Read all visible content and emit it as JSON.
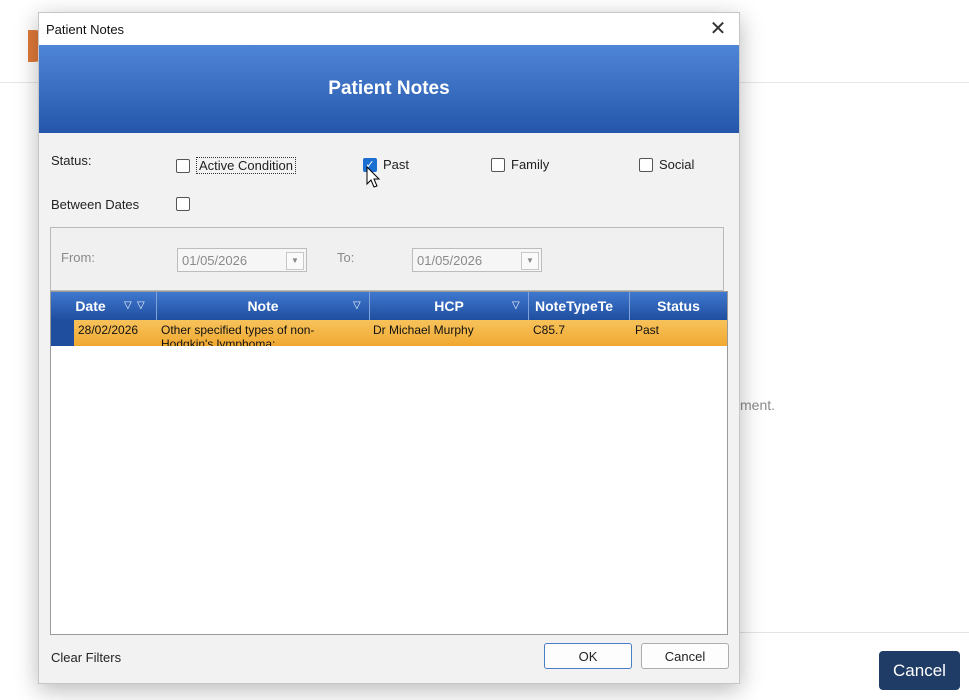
{
  "background": {
    "right_text": "ment.",
    "cancel_label": "Cancel"
  },
  "dialog": {
    "window_title": "Patient Notes",
    "close_glyph": "✕",
    "banner_title": "Patient Notes",
    "status_label": "Status:",
    "status_options": [
      {
        "label": "Active Condition",
        "checked": false
      },
      {
        "label": "Past",
        "checked": true
      },
      {
        "label": "Family",
        "checked": false
      },
      {
        "label": "Social",
        "checked": false
      }
    ],
    "between_dates_label": "Between Dates",
    "between_dates_checked": false,
    "from_label": "From:",
    "from_value": "01/05/2026",
    "to_label": "To:",
    "to_value": "01/05/2026",
    "grid": {
      "columns": [
        "Date",
        "Note",
        "HCP",
        "NoteTypeTe",
        "Status"
      ],
      "rows": [
        {
          "date": "28/02/2026",
          "note": "Other specified types of non-Hodgkin's lymphoma;",
          "hcp": "Dr Michael Murphy",
          "note_type": "C85.7",
          "status": "Past"
        }
      ]
    },
    "clear_filters_label": "Clear Filters",
    "ok_label": "OK",
    "cancel_label": "Cancel"
  },
  "colors": {
    "banner": "#2457ab",
    "header": "#1f4e9f",
    "selected_row": "#f0a830",
    "checkbox_checked": "#1a6fd1"
  },
  "icons": {
    "close": "close-icon",
    "filter": "filter-icon",
    "sort": "sort-desc-icon",
    "dropdown": "chevron-down-icon",
    "cursor": "mouse-cursor-icon"
  }
}
